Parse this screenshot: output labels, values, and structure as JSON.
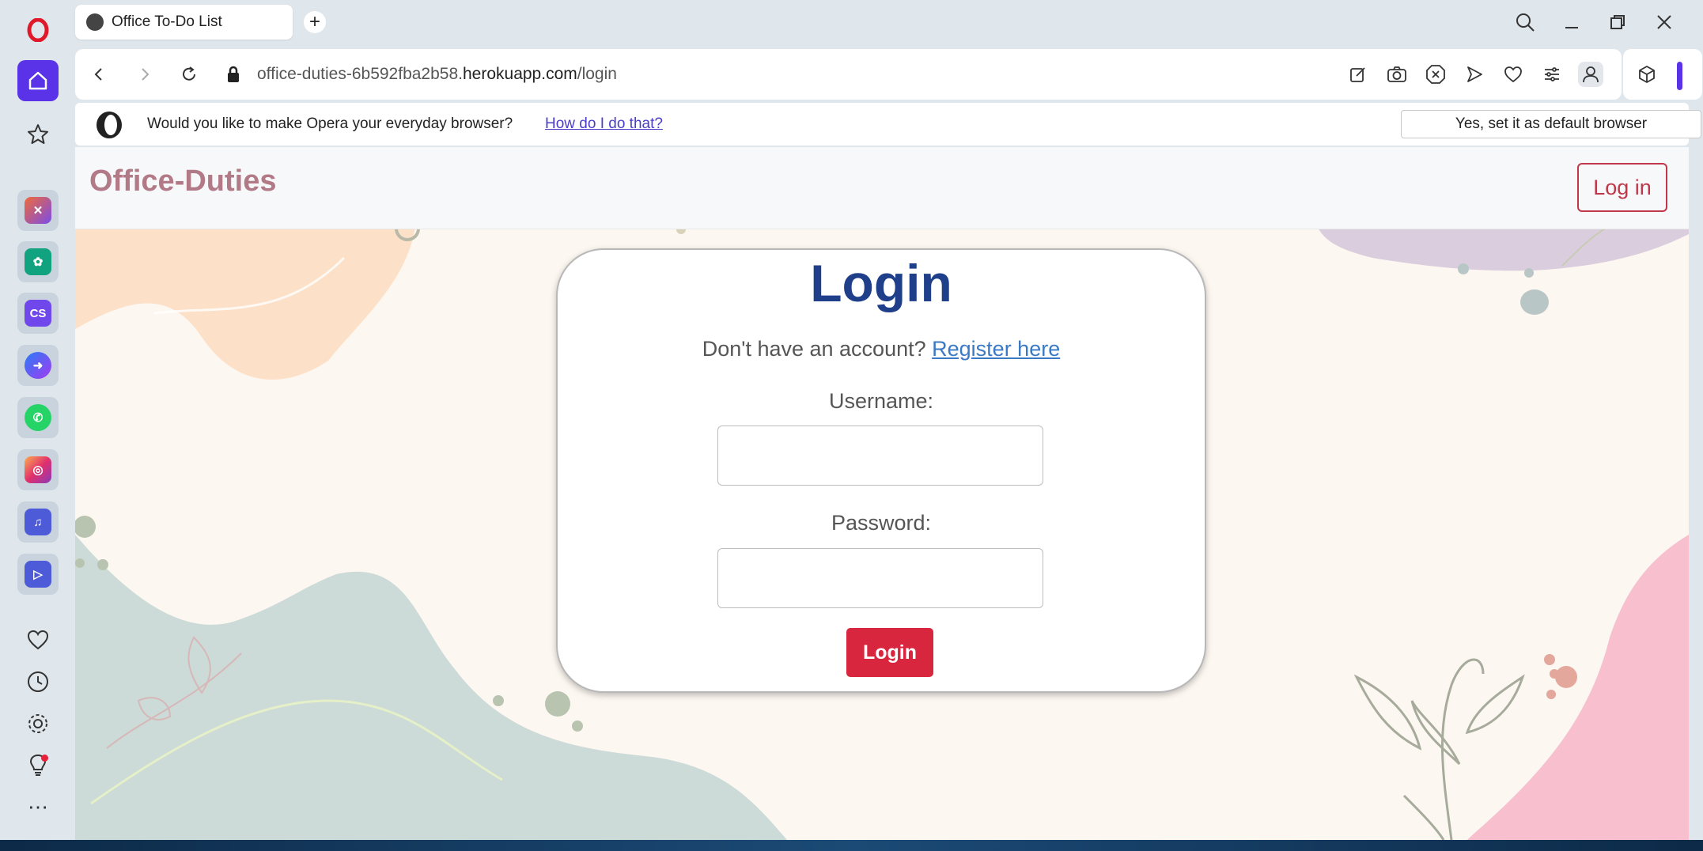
{
  "browser": {
    "tab_title": "Office To-Do List",
    "new_tab": "+",
    "url_prefix": "office-duties-6b592fba2b58.",
    "url_domain": "herokuapp.com",
    "url_path": "/login"
  },
  "infobar": {
    "message": "Would you like to make Opera your everyday browser?",
    "how_link": "How do I do that?",
    "set_default_label": "Yes, set it as default browser",
    "close": "×"
  },
  "site": {
    "brand": "Office-Duties",
    "nav_login_label": "Log in"
  },
  "login_card": {
    "title": "Login",
    "register_prompt": "Don't have an account?",
    "register_link": "Register here",
    "username_label": "Username:",
    "username_value": "",
    "password_label": "Password:",
    "password_value": "",
    "submit_label": "Login"
  },
  "colors": {
    "opera_accent": "#5a33e8",
    "brand": "#b27a86",
    "title": "#1f3f8a",
    "danger": "#d9263f"
  }
}
